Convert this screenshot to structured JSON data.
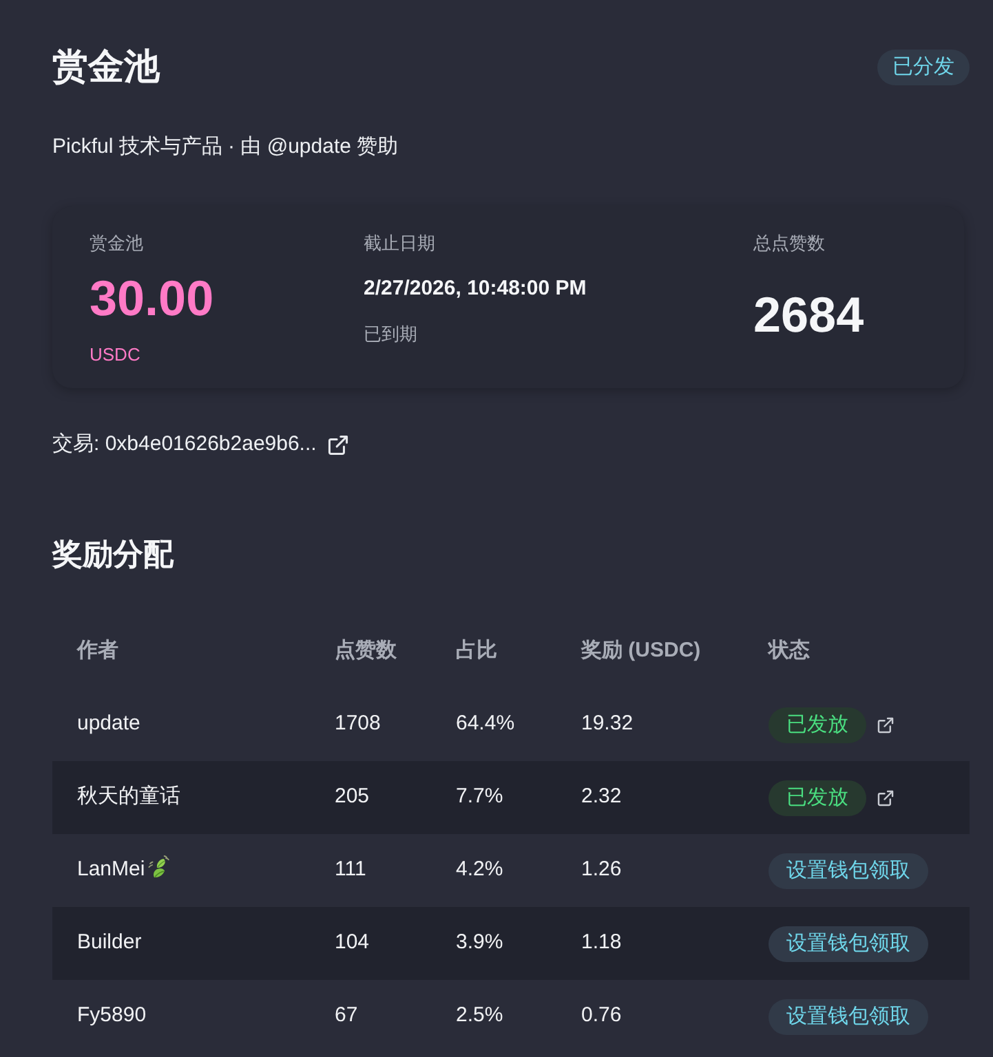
{
  "header": {
    "title": "赏金池",
    "status_badge": "已分发"
  },
  "subtitle": "Pickful 技术与产品 · 由 @update 赞助",
  "stats": [
    {
      "kind": "amount",
      "label": "赏金池",
      "value": "30.00",
      "unit": "USDC"
    },
    {
      "kind": "deadline",
      "label": "截止日期",
      "value": "2/27/2026, 10:48:00 PM",
      "note": "已到期"
    },
    {
      "kind": "total",
      "label": "总点赞数",
      "value": "2684"
    }
  ],
  "transaction": {
    "text": "交易: 0xb4e01626b2ae9b6..."
  },
  "section_title": "奖励分配",
  "table": {
    "columns": [
      "作者",
      "点赞数",
      "占比",
      "奖励 (USDC)",
      "状态"
    ],
    "rows": [
      {
        "author": "update",
        "name_icon": false,
        "likes": "1708",
        "share": "64.4%",
        "reward": "19.32",
        "status": {
          "kind": "paid",
          "label": "已发放"
        }
      },
      {
        "author": "秋天的童话",
        "name_icon": false,
        "likes": "205",
        "share": "7.7%",
        "reward": "2.32",
        "status": {
          "kind": "paid",
          "label": "已发放"
        }
      },
      {
        "author": "LanMei",
        "name_icon": true,
        "likes": "111",
        "share": "4.2%",
        "reward": "1.26",
        "status": {
          "kind": "claim",
          "label": "设置钱包领取"
        }
      },
      {
        "author": "Builder",
        "name_icon": false,
        "likes": "104",
        "share": "3.9%",
        "reward": "1.18",
        "status": {
          "kind": "claim",
          "label": "设置钱包领取"
        }
      },
      {
        "author": "Fy5890",
        "name_icon": false,
        "likes": "67",
        "share": "2.5%",
        "reward": "0.76",
        "status": {
          "kind": "claim",
          "label": "设置钱包领取"
        }
      }
    ]
  }
}
